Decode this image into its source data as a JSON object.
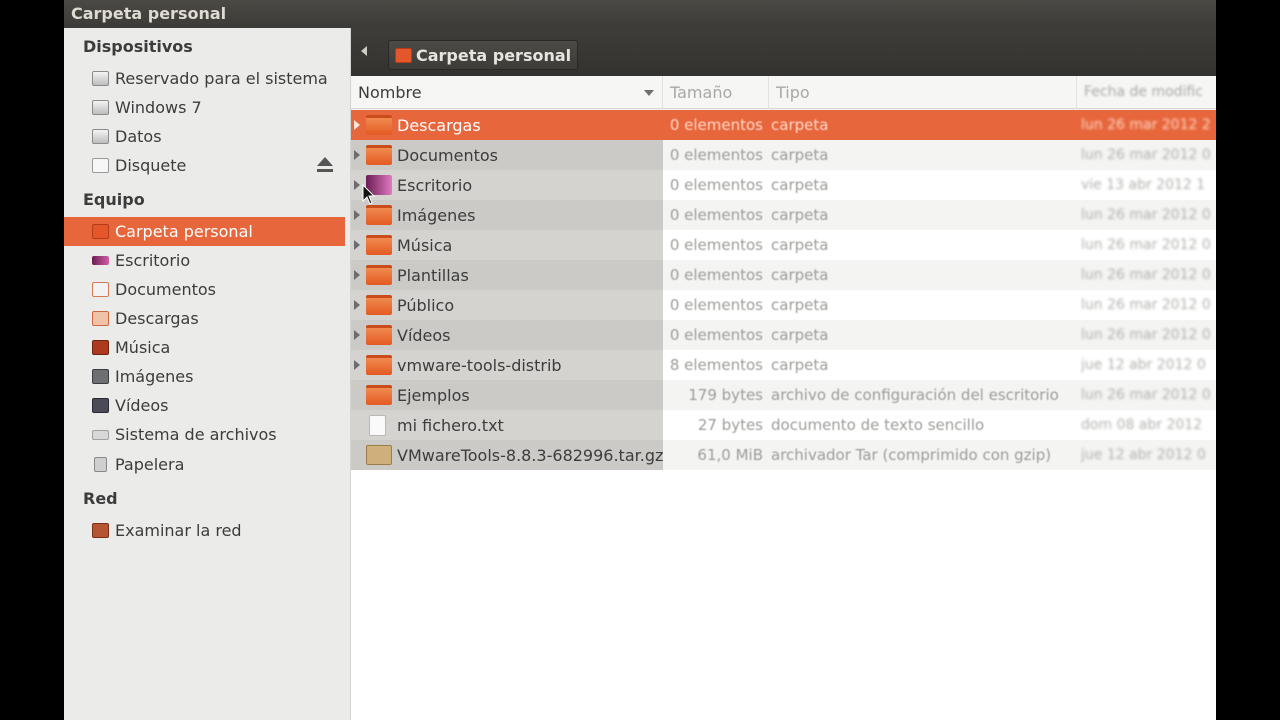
{
  "window": {
    "title": "Carpeta personal"
  },
  "sidebar": {
    "devices_heading": "Dispositivos",
    "devices": [
      {
        "label": "Reservado para el sistema",
        "icon": "hard-drive-icon"
      },
      {
        "label": "Windows 7",
        "icon": "hard-drive-icon"
      },
      {
        "label": "Datos",
        "icon": "hard-drive-icon"
      },
      {
        "label": "Disquete",
        "icon": "floppy-icon"
      }
    ],
    "computer_heading": "Equipo",
    "computer": [
      {
        "label": "Carpeta personal",
        "icon": "home-folder-icon",
        "active": true
      },
      {
        "label": "Escritorio",
        "icon": "desktop-icon"
      },
      {
        "label": "Documentos",
        "icon": "documents-icon"
      },
      {
        "label": "Descargas",
        "icon": "downloads-icon"
      },
      {
        "label": "Música",
        "icon": "music-icon"
      },
      {
        "label": "Imágenes",
        "icon": "pictures-icon"
      },
      {
        "label": "Vídeos",
        "icon": "videos-icon"
      },
      {
        "label": "Sistema de archivos",
        "icon": "filesystem-icon"
      },
      {
        "label": "Papelera",
        "icon": "trash-icon"
      }
    ],
    "network_heading": "Red",
    "network": [
      {
        "label": "Examinar la red",
        "icon": "network-icon"
      }
    ]
  },
  "toolbar": {
    "breadcrumb": "Carpeta personal"
  },
  "columns": {
    "name": "Nombre",
    "size": "Tamaño",
    "type": "Tipo",
    "date": "Fecha de modific"
  },
  "files": [
    {
      "name": "Descargas",
      "size": "0 elementos",
      "type": "carpeta",
      "date": "lun 26 mar 2012 2",
      "expandable": true,
      "icon": "folder-downloads-icon",
      "selected": true
    },
    {
      "name": "Documentos",
      "size": "0 elementos",
      "type": "carpeta",
      "date": "lun 26 mar 2012 0",
      "expandable": true,
      "icon": "folder-documents-icon"
    },
    {
      "name": "Escritorio",
      "size": "0 elementos",
      "type": "carpeta",
      "date": "vie 13 abr 2012 1",
      "expandable": true,
      "icon": "folder-desktop-icon"
    },
    {
      "name": "Imágenes",
      "size": "0 elementos",
      "type": "carpeta",
      "date": "lun 26 mar 2012 0",
      "expandable": true,
      "icon": "folder-pictures-icon"
    },
    {
      "name": "Música",
      "size": "0 elementos",
      "type": "carpeta",
      "date": "lun 26 mar 2012 0",
      "expandable": true,
      "icon": "folder-music-icon"
    },
    {
      "name": "Plantillas",
      "size": "0 elementos",
      "type": "carpeta",
      "date": "lun 26 mar 2012 0",
      "expandable": true,
      "icon": "folder-templates-icon"
    },
    {
      "name": "Público",
      "size": "0 elementos",
      "type": "carpeta",
      "date": "lun 26 mar 2012 0",
      "expandable": true,
      "icon": "folder-public-icon"
    },
    {
      "name": "Vídeos",
      "size": "0 elementos",
      "type": "carpeta",
      "date": "lun 26 mar 2012 0",
      "expandable": true,
      "icon": "folder-videos-icon"
    },
    {
      "name": "vmware-tools-distrib",
      "size": "8 elementos",
      "type": "carpeta",
      "date": "jue 12 abr 2012 0",
      "expandable": true,
      "icon": "folder-icon"
    },
    {
      "name": "Ejemplos",
      "size": "179 bytes",
      "type": "archivo de configuración del escritorio",
      "date": "lun 26 mar 2012 0",
      "expandable": false,
      "icon": "folder-link-icon"
    },
    {
      "name": "mi fichero.txt",
      "size": "27 bytes",
      "type": "documento de texto sencillo",
      "date": "dom 08 abr 2012",
      "expandable": false,
      "icon": "text-file-icon"
    },
    {
      "name": "VMwareTools-8.8.3-682996.tar.gz",
      "size": "61,0 MiB",
      "type": "archivador Tar (comprimido con gzip)",
      "date": "jue 12 abr 2012 0",
      "expandable": false,
      "icon": "archive-icon"
    }
  ]
}
